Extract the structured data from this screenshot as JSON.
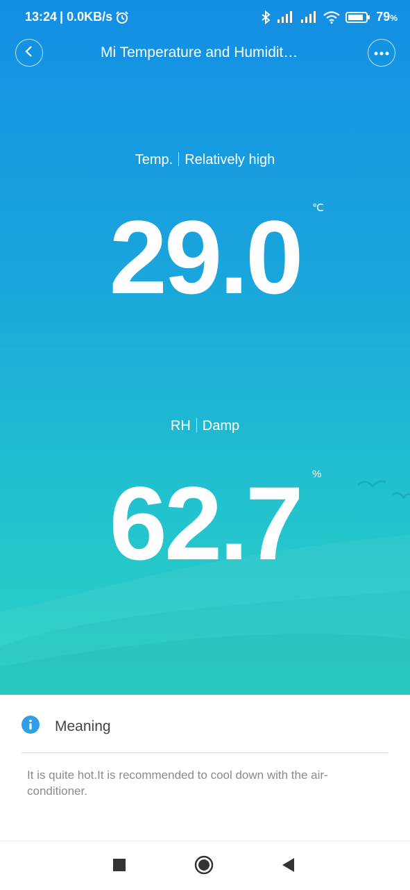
{
  "status_bar": {
    "time": "13:24",
    "network_speed": "| 0.0KB/s",
    "battery": "79",
    "battery_unit": "%"
  },
  "header": {
    "title": "Mi Temperature and Humidit…"
  },
  "temperature": {
    "label": "Temp.",
    "status": "Relatively high",
    "value": "29.0",
    "unit": "℃"
  },
  "humidity": {
    "label": "RH",
    "status": "Damp",
    "value": "62.7",
    "unit": "%"
  },
  "meaning": {
    "title": "Meaning",
    "text": "It is quite hot.It is recommended to cool down with the air-conditioner."
  },
  "colors": {
    "gradient_top": "#138ee4",
    "gradient_bottom": "#2bd3c3",
    "info_icon": "#2f9fe8"
  },
  "icons": [
    "alarm-icon",
    "bluetooth-icon",
    "signal-icon",
    "wifi-icon",
    "battery-icon",
    "back-icon",
    "more-icon",
    "info-icon",
    "square-icon",
    "home-circle-icon",
    "triangle-back-icon"
  ]
}
